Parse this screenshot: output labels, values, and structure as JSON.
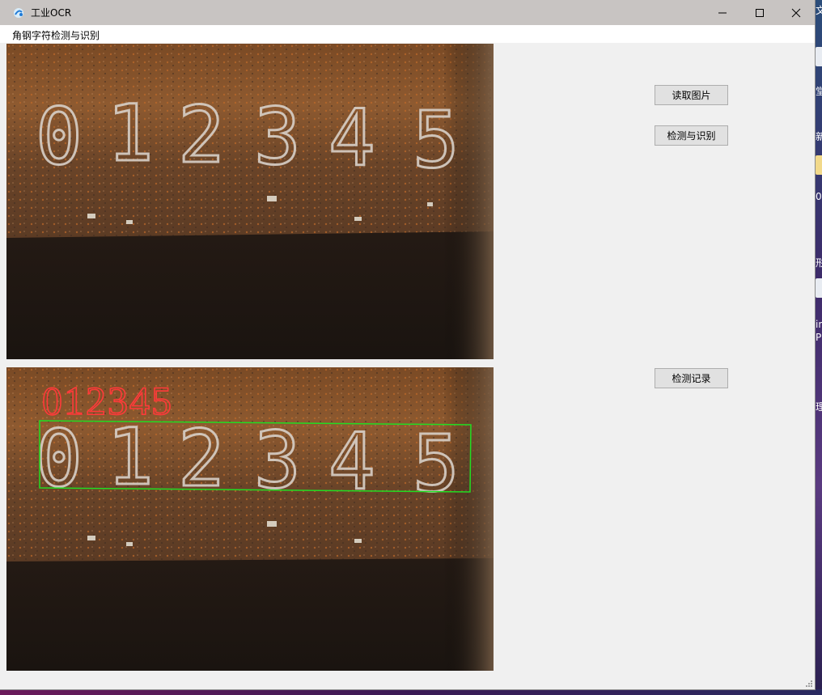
{
  "window": {
    "title": "工业OCR"
  },
  "menu": {
    "items": [
      "角钢字符检测与识别"
    ]
  },
  "buttons": {
    "read_image": "读取图片",
    "detect_recognize": "检测与识别",
    "detect_records": "检测记录"
  },
  "panels": {
    "original": {
      "stamped_digits": [
        "0",
        "1",
        "2",
        "3",
        "4",
        "5"
      ]
    },
    "result": {
      "stamped_digits": [
        "0",
        "1",
        "2",
        "3",
        "4",
        "5"
      ],
      "recognized_text": "012345",
      "overlay_text_color": "#ff3a3a",
      "box_color": "#22dd22"
    }
  },
  "desktop": {
    "edge_glyphs": [
      "文",
      "堂",
      "新",
      "0",
      "形",
      "in",
      "P",
      "理"
    ]
  },
  "colors": {
    "titlebar": "#c8c4c2",
    "window_bg": "#f0f0f0",
    "button_bg": "#e1e1e1",
    "button_border": "#adadad"
  }
}
